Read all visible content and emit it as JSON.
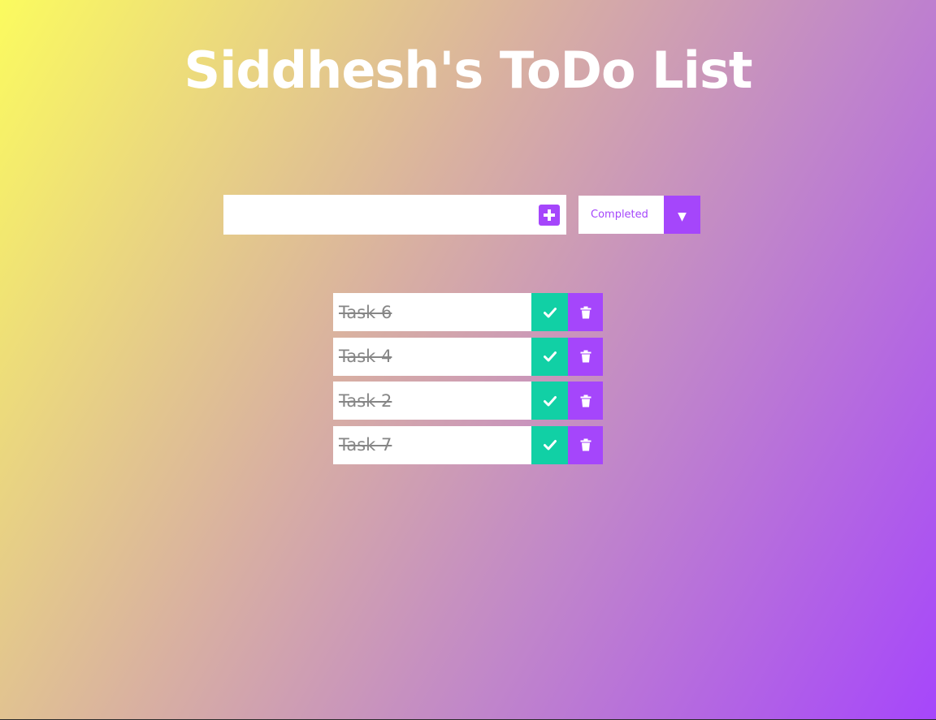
{
  "header": {
    "title": "Siddhesh's ToDo List"
  },
  "form": {
    "input_value": "",
    "add_icon": "plus-square-icon"
  },
  "filter": {
    "selected": "Completed",
    "arrow": "▼"
  },
  "todos": [
    {
      "text": "Task 6",
      "completed": true
    },
    {
      "text": "Task 4",
      "completed": true
    },
    {
      "text": "Task 2",
      "completed": true
    },
    {
      "text": "Task 7",
      "completed": true
    }
  ],
  "colors": {
    "accent": "#a546fb",
    "complete": "#11d0a5",
    "title": "#ffffff",
    "completed_text": "#7a7a7a"
  },
  "icons": {
    "complete": "check-icon",
    "delete": "trash-icon"
  }
}
